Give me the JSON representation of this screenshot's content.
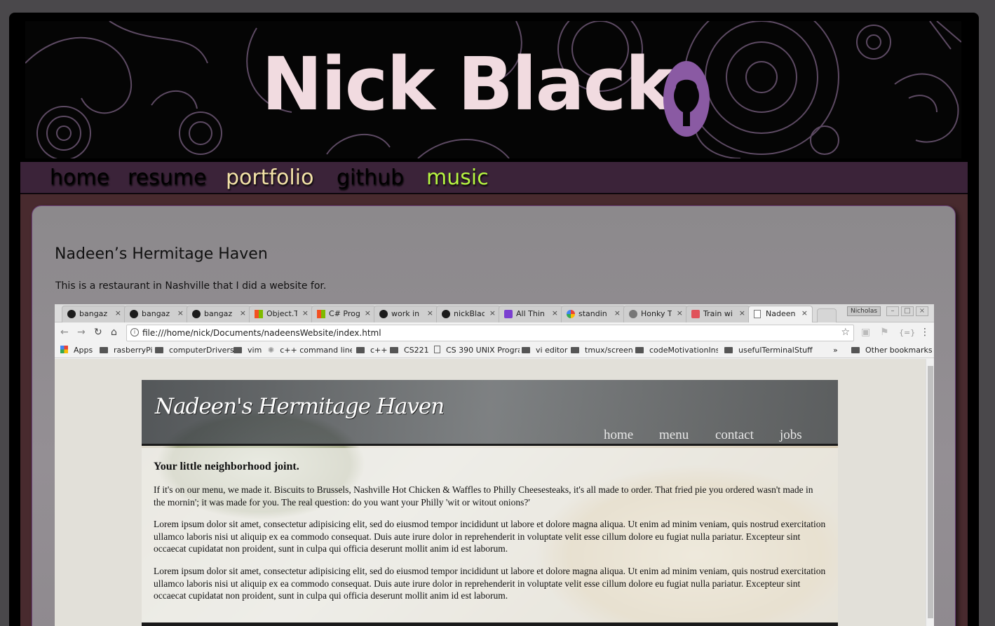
{
  "site": {
    "title": "Nick Black",
    "nav": [
      {
        "label": "home",
        "color": "#ffffff"
      },
      {
        "label": "resume",
        "color": "#ffffff"
      },
      {
        "label": "portfolio",
        "color": "#f4e3a8"
      },
      {
        "label": "github",
        "color": "#ffffff"
      },
      {
        "label": "music",
        "color": "#b6f542"
      }
    ]
  },
  "project": {
    "title": "Nadeen’s Hermitage Haven",
    "description": "This is a restaurant in Nashville that I did a website for."
  },
  "browser": {
    "tabs": [
      {
        "label": "bangaz",
        "icon": "github-icon"
      },
      {
        "label": "bangaz",
        "icon": "github-icon"
      },
      {
        "label": "bangaz",
        "icon": "github-icon"
      },
      {
        "label": "Object.T",
        "icon": "microsoft-icon"
      },
      {
        "label": "C# Prog",
        "icon": "microsoft-icon"
      },
      {
        "label": "work in",
        "icon": "github-icon"
      },
      {
        "label": "nickBlac",
        "icon": "github-icon"
      },
      {
        "label": "All Thin",
        "icon": "purple-app-icon"
      },
      {
        "label": "standin",
        "icon": "google-icon"
      },
      {
        "label": "Honky T",
        "icon": "gear-icon"
      },
      {
        "label": "Train wi",
        "icon": "red-app-icon"
      },
      {
        "label": "Nadeen",
        "icon": "document-icon"
      }
    ],
    "tab_close": "×",
    "profile": "Nicholas",
    "url": "file:///home/nick/Documents/nadeensWebsite/index.html",
    "bookmarks": [
      {
        "label": "Apps"
      },
      {
        "label": "rasberryPi"
      },
      {
        "label": "computerDrivers"
      },
      {
        "label": "vim"
      },
      {
        "label": "c++ command line V"
      },
      {
        "label": "c++"
      },
      {
        "label": "CS221"
      },
      {
        "label": "CS 390 UNIX Progra"
      },
      {
        "label": "vi editor"
      },
      {
        "label": "tmux/screen"
      },
      {
        "label": "codeMotivationInsp"
      },
      {
        "label": "usefulTerminalStuff"
      }
    ],
    "bookmarks_overflow": "»",
    "other_bookmarks": "Other bookmarks"
  },
  "mini_site": {
    "brand": "Nadeen's Hermitage Haven",
    "nav": [
      "home",
      "menu",
      "contact",
      "jobs"
    ],
    "heading": "Your little neighborhood joint.",
    "paragraphs": [
      "If it's on our menu, we made it. Biscuits to Brussels, Nashville Hot Chicken & Waffles to Philly Cheesesteaks, it's all made to order. That fried pie you ordered wasn't made in the mornin'; it was made for you. The real question: do you want your Philly 'wit or witout onions?'",
      "Lorem ipsum dolor sit amet, consectetur adipisicing elit, sed do eiusmod tempor incididunt ut labore et dolore magna aliqua. Ut enim ad minim veniam, quis nostrud exercitation ullamco laboris nisi ut aliquip ex ea commodo consequat. Duis aute irure dolor in reprehenderit in voluptate velit esse cillum dolore eu fugiat nulla pariatur. Excepteur sint occaecat cupidatat non proident, sunt in culpa qui officia deserunt mollit anim id est laborum.",
      "Lorem ipsum dolor sit amet, consectetur adipisicing elit, sed do eiusmod tempor incididunt ut labore et dolore magna aliqua. Ut enim ad minim veniam, quis nostrud exercitation ullamco laboris nisi ut aliquip ex ea commodo consequat. Duis aute irure dolor in reprehenderit in voluptate velit esse cillum dolore eu fugiat nulla pariatur. Excepteur sint occaecat cupidatat non proident, sunt in culpa qui officia deserunt mollit anim id est laborum."
    ]
  }
}
